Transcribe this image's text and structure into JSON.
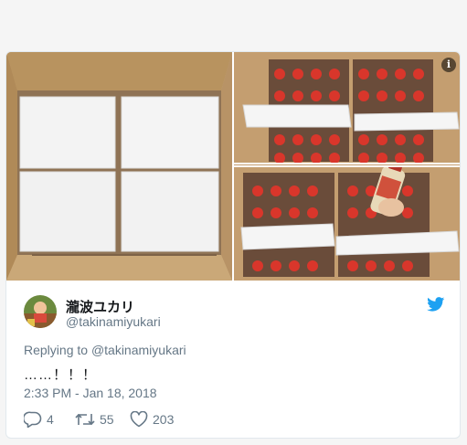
{
  "tweet": {
    "author_name": "瀧波ユカリ",
    "author_handle": "@takinamiyukari",
    "replying_prefix": "Replying to ",
    "replying_to": "@takinamiyukari",
    "text": "……！！！",
    "timestamp": "2:33 PM - Jan 18, 2018",
    "reply_count": "4",
    "retweet_count": "55",
    "like_count": "203"
  },
  "media": {
    "photo_count": 3,
    "info_icon_label": "i"
  },
  "colors": {
    "twitter_blue": "#1da1f2",
    "secondary_text": "#657786",
    "primary_text": "#14171a",
    "border": "#e1e8ed"
  },
  "icons": [
    "info-icon",
    "twitter-bird-icon",
    "reply-icon",
    "retweet-icon",
    "like-icon"
  ]
}
